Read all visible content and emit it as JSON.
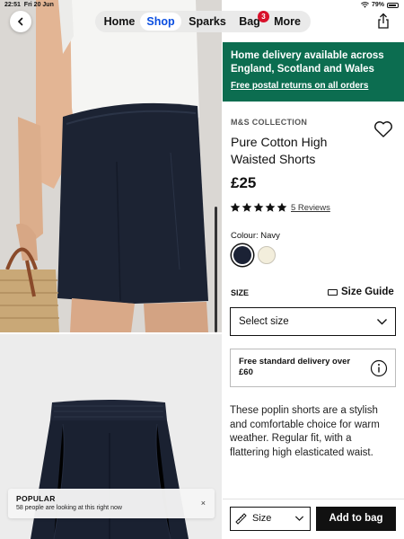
{
  "status_bar": {
    "time": "22:51",
    "date": "Fri 20 Jun",
    "battery": "79%"
  },
  "nav": {
    "items": [
      {
        "label": "Home"
      },
      {
        "label": "Shop"
      },
      {
        "label": "Sparks"
      },
      {
        "label": "Bag"
      },
      {
        "label": "More"
      }
    ],
    "active": "Shop",
    "bag_count": "3"
  },
  "banner": {
    "title": "Home delivery available across England, Scotland and Wales",
    "link": "Free postal returns on all orders",
    "color": "#0c6d50"
  },
  "product": {
    "brand": "M&S COLLECTION",
    "title": "Pure Cotton High Waisted Shorts",
    "price": "£25",
    "rating": 5,
    "reviews": "5 Reviews",
    "colour_label": "Colour:",
    "colour_value": "Navy",
    "swatches": [
      {
        "name": "Navy",
        "color": "#1b2235"
      },
      {
        "name": "Cream",
        "color": "#f3eedc"
      }
    ]
  },
  "size": {
    "label": "SIZE",
    "guide": "Size Guide",
    "select_placeholder": "Select size"
  },
  "delivery_info": "Free standard delivery over £60",
  "description": "These poplin shorts are a stylish and comfortable choice for warm weather. Regular fit, with a flattering high elasticated waist.",
  "bottom_bar": {
    "size_label": "Size",
    "add_to_bag": "Add to bag"
  },
  "toast": {
    "title": "POPULAR",
    "text": "58 people are looking at this right now",
    "close": "×"
  }
}
